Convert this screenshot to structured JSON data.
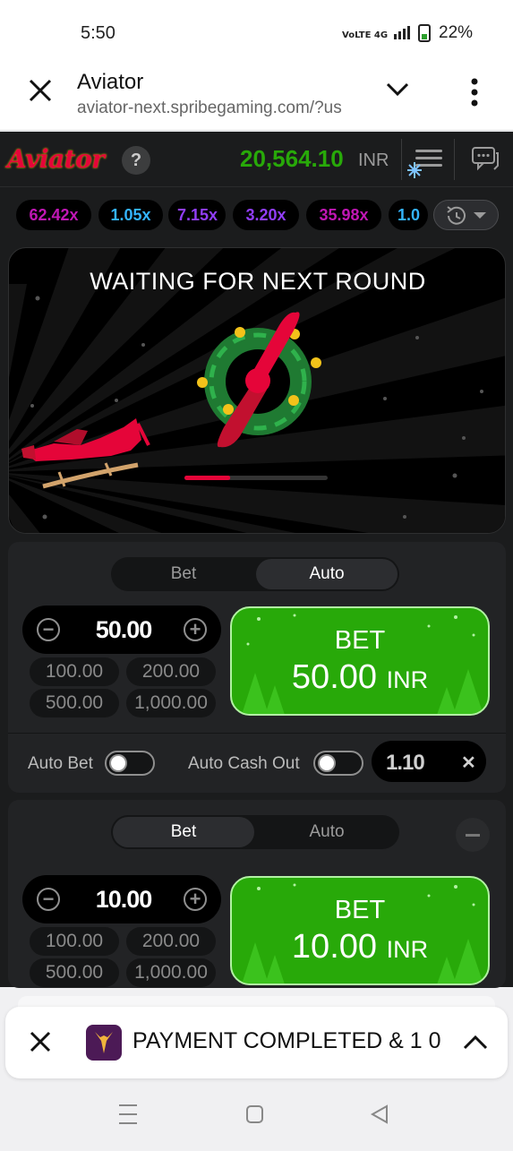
{
  "status_bar": {
    "time": "5:50",
    "signal_text": "VoLTE 4G",
    "battery": "22%"
  },
  "browser": {
    "title": "Aviator",
    "url": "aviator-next.spribegaming.com/?us"
  },
  "game": {
    "logo": "Aviator",
    "help": "?",
    "balance": "20,564.10",
    "currency": "INR",
    "history": [
      "62.42x",
      "1.05x",
      "7.15x",
      "3.20x",
      "35.98x",
      "1.0"
    ],
    "history_colors": [
      "#c017b4",
      "#34b4ff",
      "#913ef8",
      "#913ef8",
      "#c017b4",
      "#34b4ff"
    ],
    "status_text": "WAITING FOR NEXT ROUND",
    "next_round_progress": 0.32
  },
  "panel1": {
    "tabs": [
      "Bet",
      "Auto"
    ],
    "active_tab": "Auto",
    "stake": "50.00",
    "quick_bets": [
      "100.00",
      "200.00",
      "500.00",
      "1,000.00"
    ],
    "bet_label": "BET",
    "bet_amount": "50.00",
    "bet_currency": "INR",
    "auto_bet_label": "Auto Bet",
    "auto_cashout_label": "Auto Cash Out",
    "cashout_value": "1.10"
  },
  "panel2": {
    "tabs": [
      "Bet",
      "Auto"
    ],
    "active_tab": "Bet",
    "stake": "10.00",
    "quick_bets": [
      "100.00",
      "200.00",
      "500.00",
      "1,000.00"
    ],
    "bet_label": "BET",
    "bet_amount": "10.00",
    "bet_currency": "INR"
  },
  "notification": {
    "message": "PAYMENT COMPLETED & 1 0"
  },
  "colors": {
    "accent_red": "#e50539",
    "bet_green": "#28a909",
    "balance_green": "#28a909"
  }
}
